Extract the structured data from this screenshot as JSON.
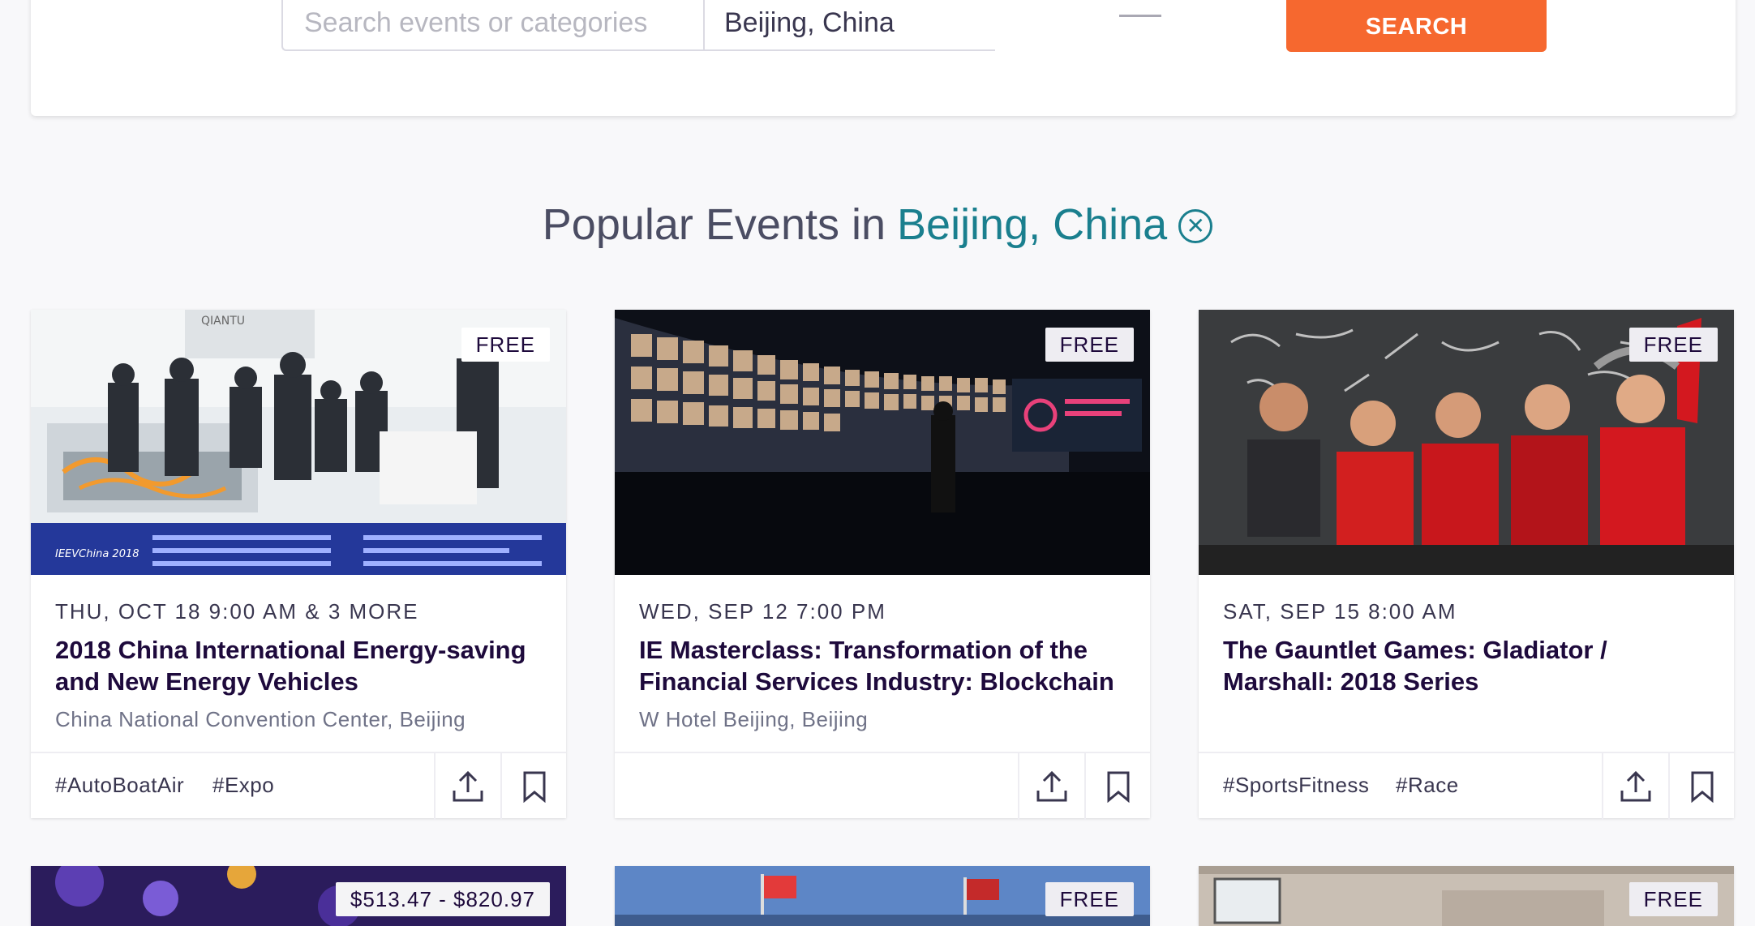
{
  "search": {
    "placeholder": "Search events or categories",
    "location": "Beijing, China",
    "button_label": "SEARCH"
  },
  "heading": {
    "prefix": "Popular Events in",
    "location": "Beijing, China",
    "clear_icon": "close-circle-icon"
  },
  "events": [
    {
      "price": "FREE",
      "date": "THU, OCT 18 9:00 AM & 3 MORE",
      "title": "2018 China International Energy-saving and New Energy Vehicles",
      "venue": "China National Convention Center, Beijing",
      "tags": [
        "#AutoBoatAir",
        "#Expo"
      ]
    },
    {
      "price": "FREE",
      "date": "WED, SEP 12 7:00 PM",
      "title": "IE Masterclass: Transformation of the Financial Services Industry: Blockchain",
      "venue": "W Hotel Beijing, Beijing",
      "tags": []
    },
    {
      "price": "FREE",
      "date": "SAT, SEP 15 8:00 AM",
      "title": "The Gauntlet Games: Gladiator / Marshall: 2018 Series",
      "venue": "",
      "tags": [
        "#SportsFitness",
        "#Race"
      ]
    },
    {
      "price": "$513.47 - $820.97"
    },
    {
      "price": "FREE"
    },
    {
      "price": "FREE"
    }
  ],
  "icons": {
    "share": "share-icon",
    "save": "bookmark-icon"
  },
  "colors": {
    "accent": "#f6682f",
    "location": "#1a7f8e"
  }
}
